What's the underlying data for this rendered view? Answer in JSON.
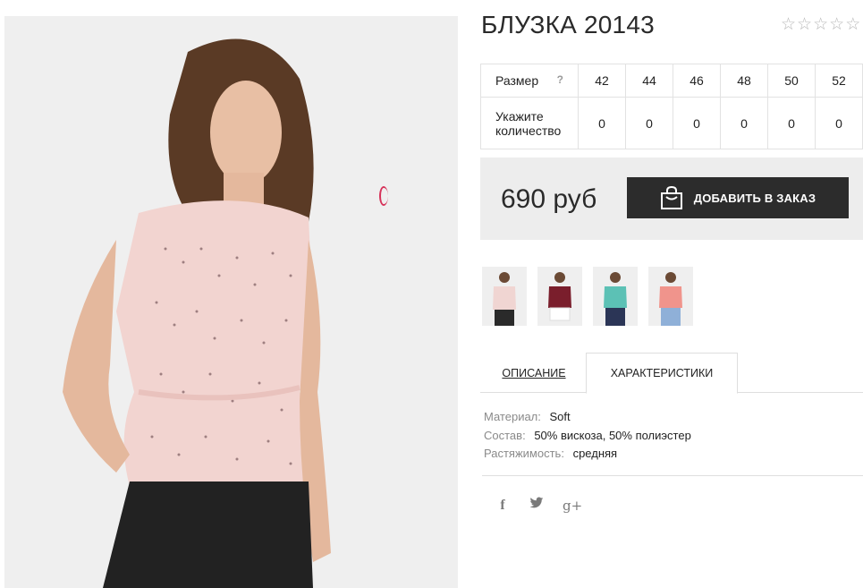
{
  "product": {
    "title": "БЛУЗКА 20143",
    "rating": 0,
    "rating_max": 5,
    "main_image_alt": "product-photo-pink-polka-dot-blouse"
  },
  "size_table": {
    "size_label": "Размер",
    "help_icon": "?",
    "qty_label": "Укажите количество",
    "sizes": [
      "42",
      "44",
      "46",
      "48",
      "50",
      "52"
    ],
    "quantities": [
      "0",
      "0",
      "0",
      "0",
      "0",
      "0"
    ]
  },
  "price": {
    "value": "690 руб",
    "button_label": "ДОБАВИТЬ В ЗАКАЗ",
    "button_icon": "shopping-bag-icon",
    "button_color": "#2c2c2c",
    "box_color": "#ededed"
  },
  "thumbnails": [
    {
      "name": "thumb-pink",
      "color": "#f0d5d2"
    },
    {
      "name": "thumb-burgundy",
      "color": "#7a1e2c"
    },
    {
      "name": "thumb-mint",
      "color": "#5cc1b5"
    },
    {
      "name": "thumb-coral",
      "color": "#f0948c"
    }
  ],
  "tabs": {
    "description": "ОПИСАНИЕ",
    "characteristics": "ХАРАКТЕРИСТИКИ",
    "active": "characteristics"
  },
  "characteristics": [
    {
      "key": "Материал:",
      "value": "Soft"
    },
    {
      "key": "Состав:",
      "value": "50% вискоза, 50% полиэстер"
    },
    {
      "key": "Растяжимость:",
      "value": "средняя"
    }
  ],
  "social": {
    "facebook": "f",
    "twitter": "🐦",
    "google_plus": "g+"
  },
  "stars_glyph": "☆"
}
